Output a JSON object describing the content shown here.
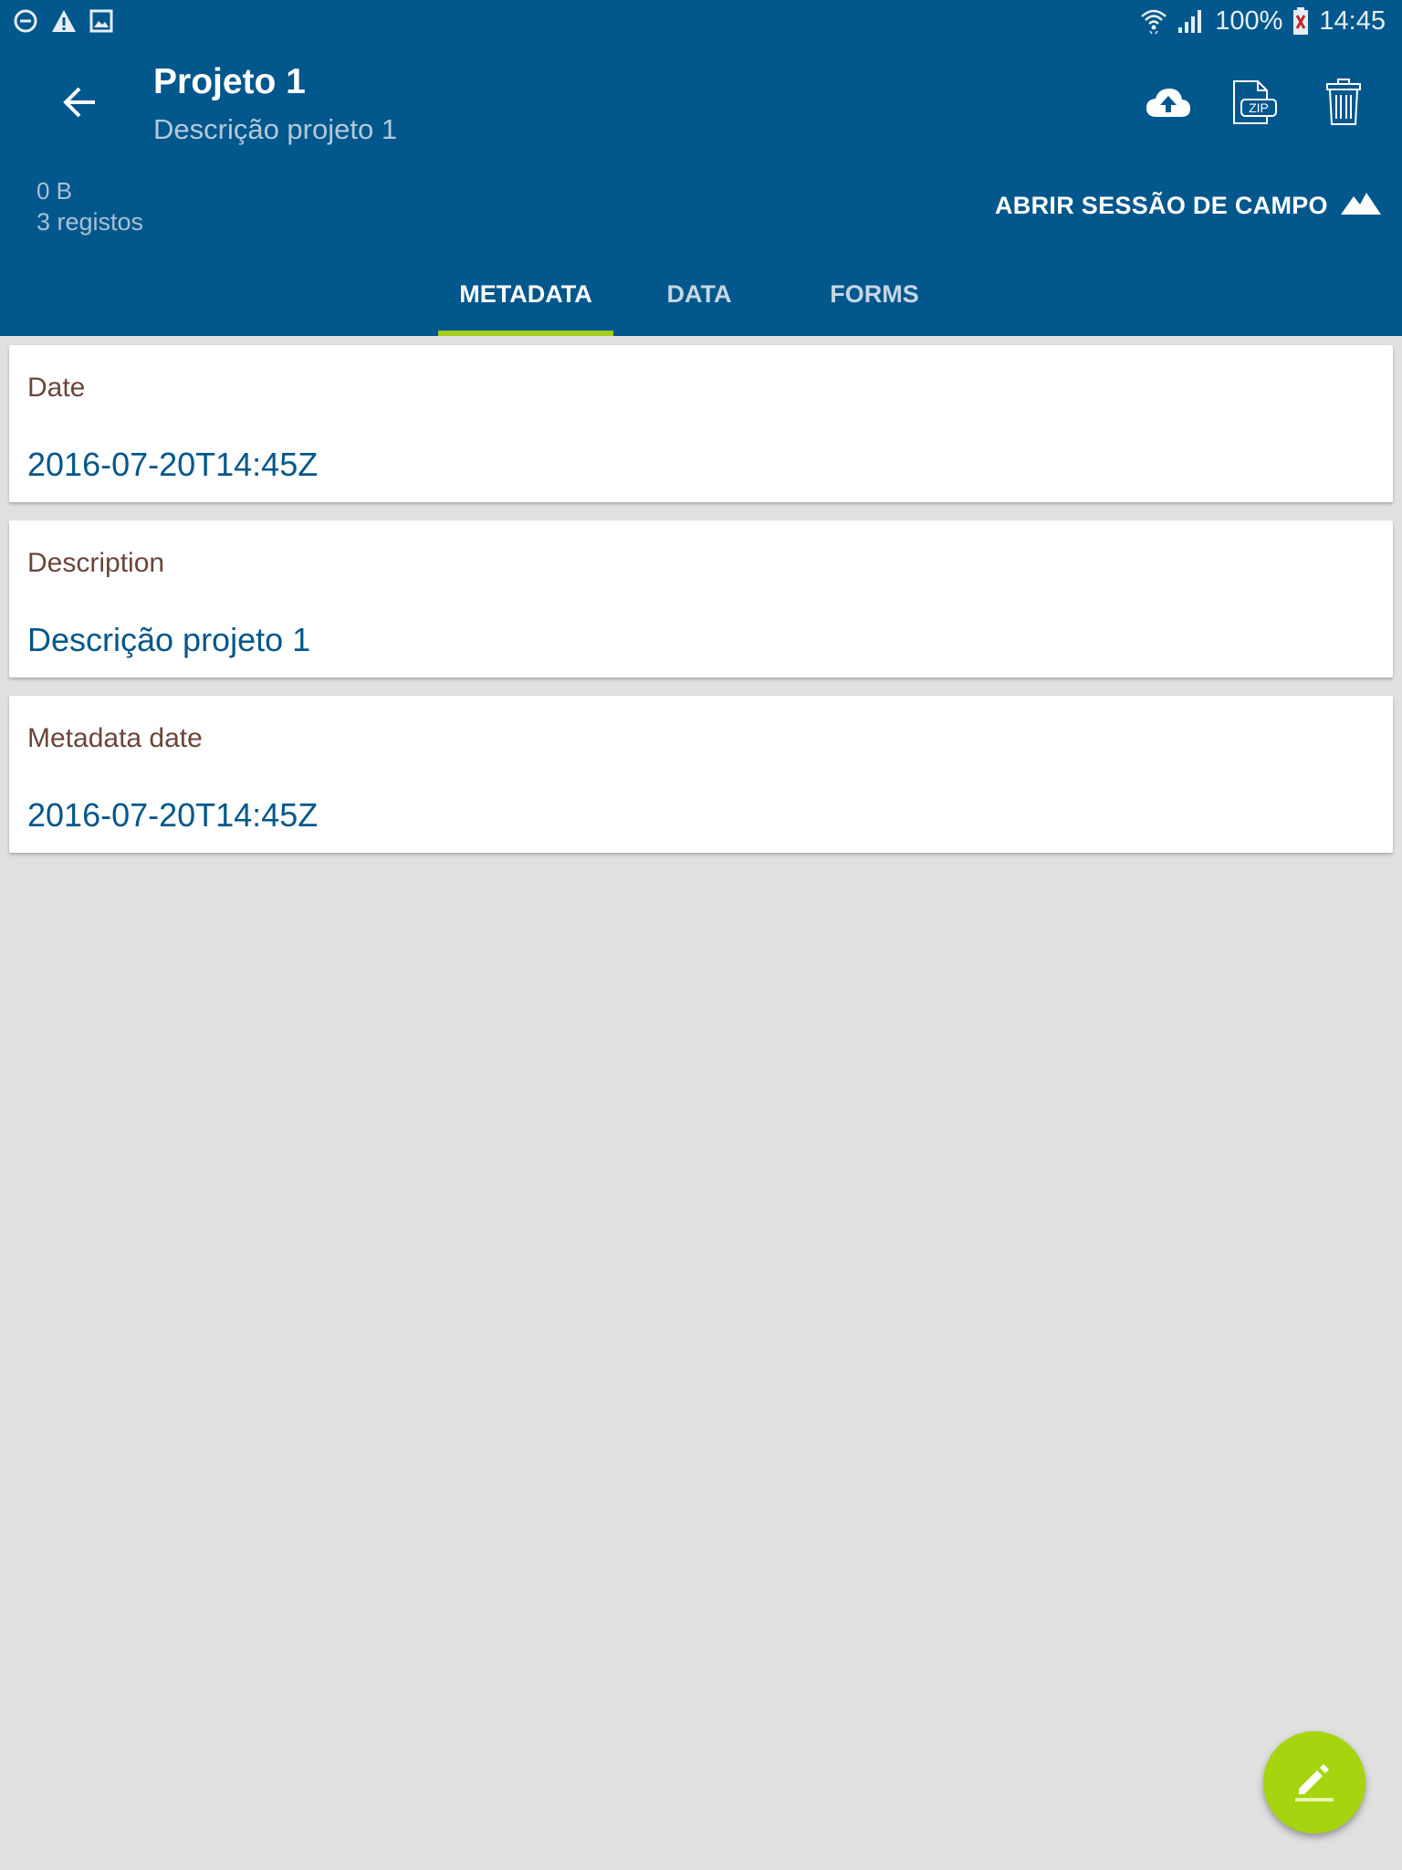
{
  "status_bar": {
    "battery": "100%",
    "time": "14:45",
    "icons_left": [
      "do-not-disturb-icon",
      "warning-icon",
      "image-icon"
    ],
    "icons_right": [
      "wifi-icon",
      "signal-icon",
      "battery-icon"
    ]
  },
  "toolbar": {
    "title": "Projeto 1",
    "subtitle": "Descrição projeto 1",
    "back_icon": "arrow-back-icon",
    "actions": [
      "cloud-upload-icon",
      "zip-file-icon",
      "trash-icon"
    ]
  },
  "project_info": {
    "size": "0 B",
    "records": "3 registos",
    "field_session_label": "ABRIR SESSÃO DE CAMPO",
    "field_session_icon": "mountain-icon"
  },
  "tabs": [
    {
      "label": "METADATA",
      "selected": true
    },
    {
      "label": "DATA",
      "selected": false
    },
    {
      "label": "FORMS",
      "selected": false
    }
  ],
  "cards": [
    {
      "label": "Date",
      "value": "2016-07-20T14:45Z"
    },
    {
      "label": "Description",
      "value": "Descrição projeto 1"
    },
    {
      "label": "Metadata date",
      "value": "2016-07-20T14:45Z"
    }
  ],
  "fab": {
    "icon": "edit-icon"
  },
  "colors": {
    "primary": "#02578c",
    "accent": "#a6d40e",
    "label_brown": "#6b4539",
    "background": "#e0e0e0"
  }
}
